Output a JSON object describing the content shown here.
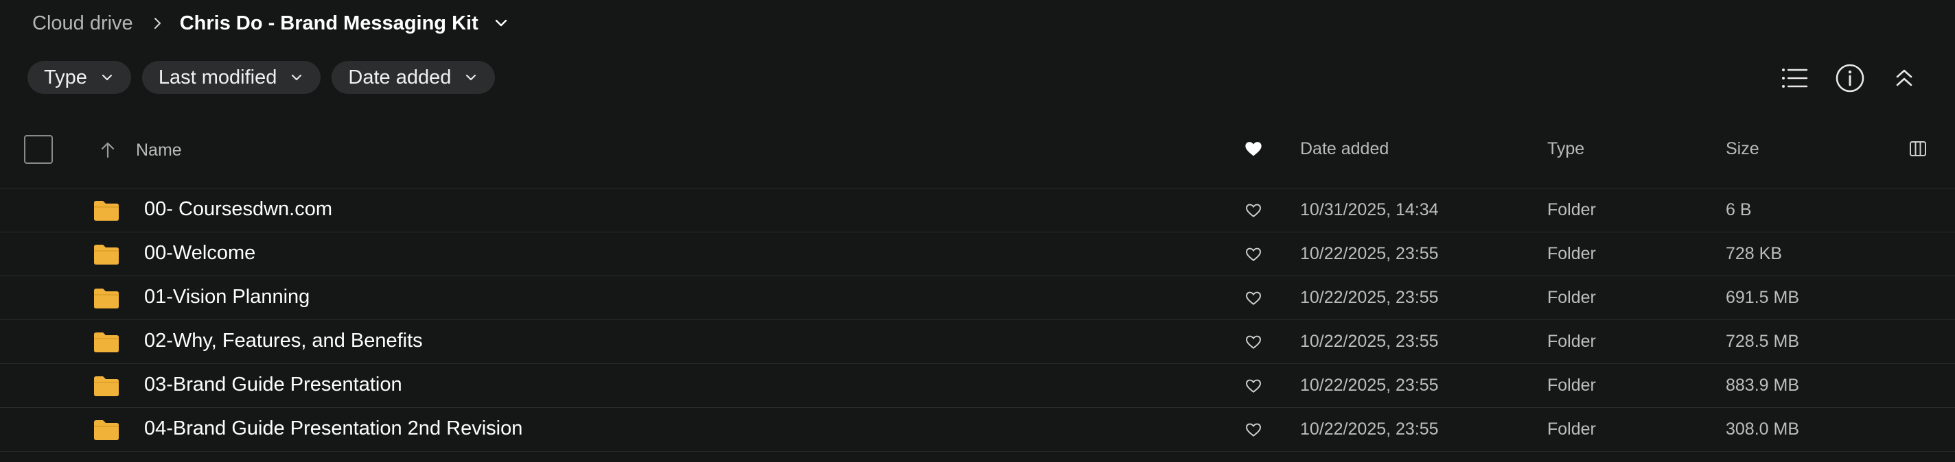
{
  "breadcrumb": {
    "root": "Cloud drive",
    "current": "Chris Do - Brand Messaging Kit"
  },
  "filters": [
    {
      "label": "Type"
    },
    {
      "label": "Last modified"
    },
    {
      "label": "Date added"
    }
  ],
  "toolbar": {
    "icons": [
      "list-view-icon",
      "info-icon",
      "collapse-icon"
    ]
  },
  "table": {
    "columns": {
      "name": "Name",
      "date_added": "Date added",
      "type": "Type",
      "size": "Size"
    },
    "sort": "ascending",
    "rows": [
      {
        "name": "00- Coursesdwn.com",
        "date_added": "10/31/2025, 14:34",
        "type": "Folder",
        "size": "6 B"
      },
      {
        "name": "00-Welcome",
        "date_added": "10/22/2025, 23:55",
        "type": "Folder",
        "size": "728 KB"
      },
      {
        "name": "01-Vision Planning",
        "date_added": "10/22/2025, 23:55",
        "type": "Folder",
        "size": "691.5 MB"
      },
      {
        "name": "02-Why, Features, and Benefits",
        "date_added": "10/22/2025, 23:55",
        "type": "Folder",
        "size": "728.5 MB"
      },
      {
        "name": "03-Brand Guide Presentation",
        "date_added": "10/22/2025, 23:55",
        "type": "Folder",
        "size": "883.9 MB"
      },
      {
        "name": "04-Brand Guide Presentation 2nd Revision",
        "date_added": "10/22/2025, 23:55",
        "type": "Folder",
        "size": "308.0 MB"
      }
    ]
  },
  "colors": {
    "background": "#151616",
    "chip": "#2c2d2e",
    "folder": "#f1b23a",
    "text": "#ffffff",
    "muted": "#bdbdbd"
  }
}
